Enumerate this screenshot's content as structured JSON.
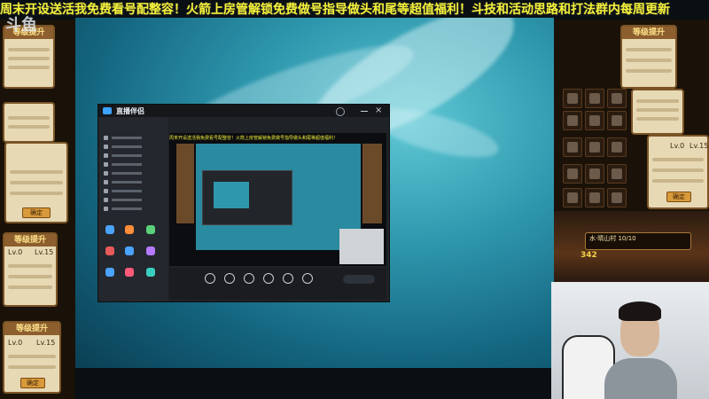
{
  "banner": {
    "text": "周末开设送活我免费看号配整容！火箭上房管解锁免费做号指导做头和尾等超值福利！斗技和活动思路和打法群内每周更新"
  },
  "logo": {
    "text": "斗鱼"
  },
  "cards": {
    "upgrade_title": "等级提升",
    "lv_left": "Lv.0",
    "lv_right": "Lv.15",
    "confirm": "确定"
  },
  "app": {
    "name": "直播伴侣",
    "ticker": "周末开设送活我免费看号配整容！火箭上房管解锁免费做号指导做头和尾等超值福利！"
  },
  "game": {
    "bar_text": "水·晴山村 10/10",
    "gold": "342"
  },
  "colors": {
    "banner": "#f4f23a",
    "water": "#2e97ad",
    "panel_bg": "#1a1208",
    "card_bg": "#e8d9b5",
    "card_title": "#8d5f2e"
  },
  "icons": [
    "search-icon",
    "close-icon",
    "minimize-icon",
    "settings-icon",
    "microphone-icon",
    "camera-icon",
    "speaker-icon"
  ]
}
